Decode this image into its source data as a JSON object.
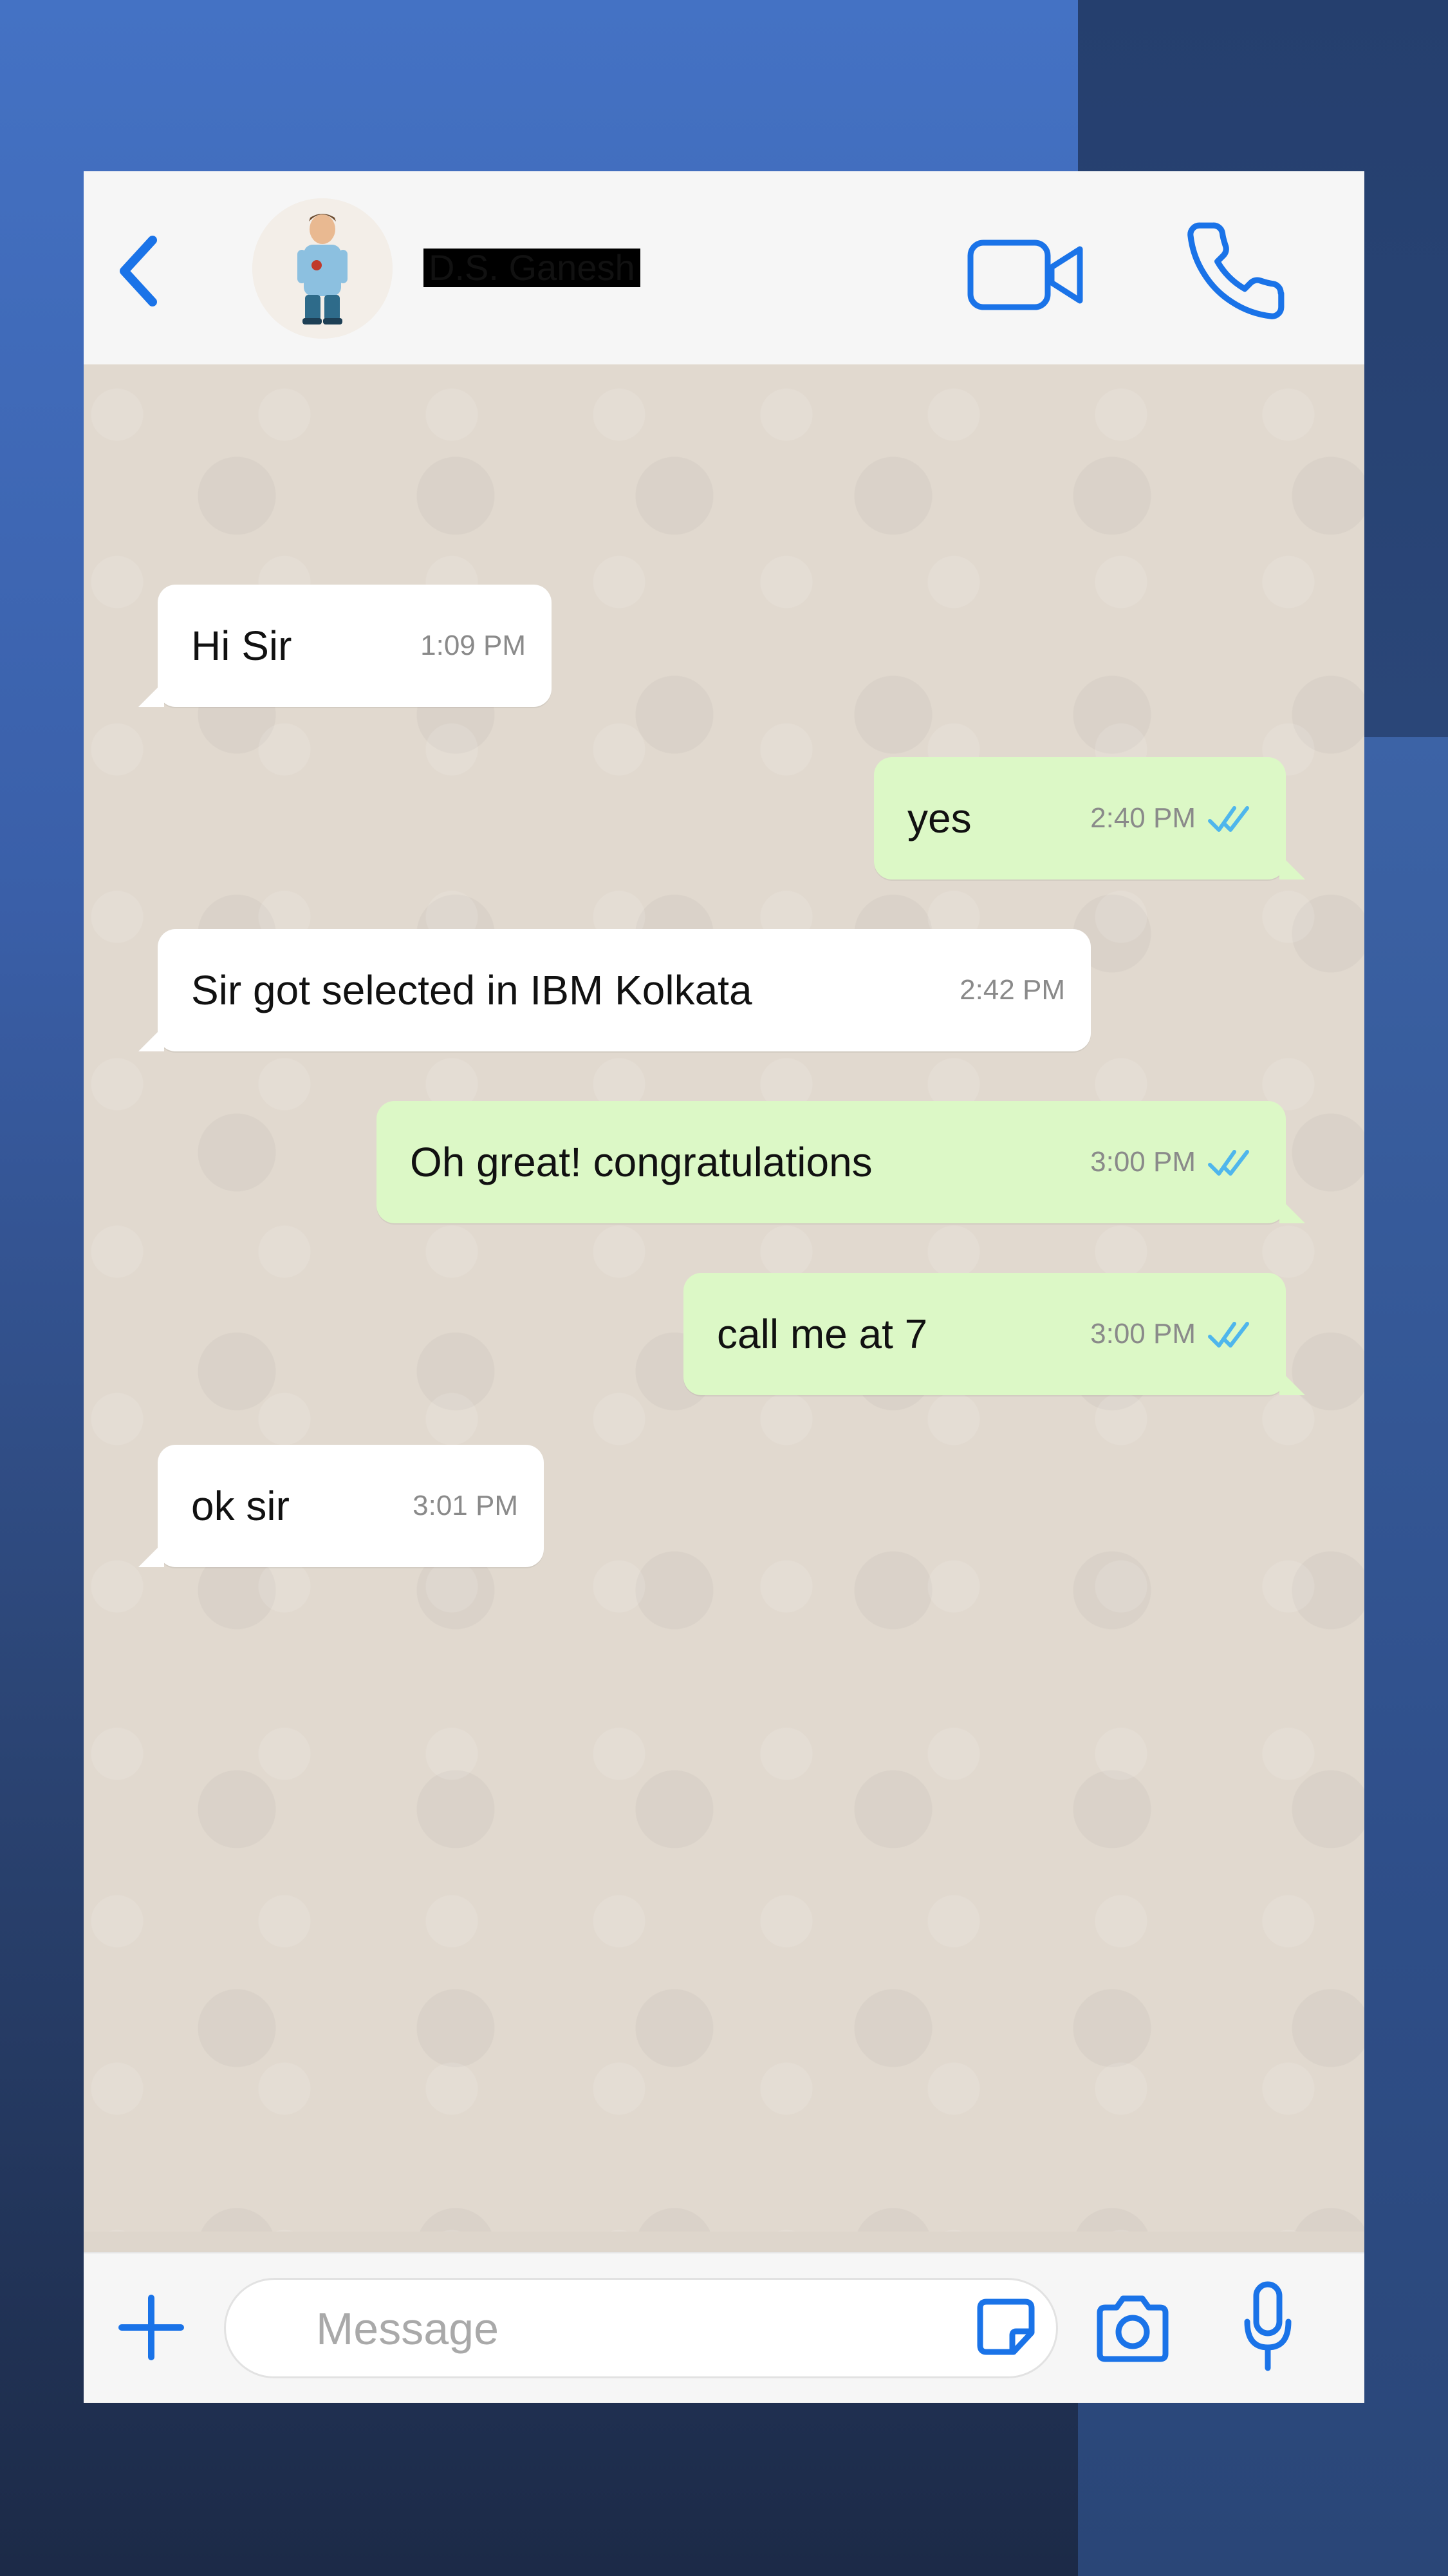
{
  "header": {
    "contact_name": "D.S. Ganesh",
    "back_icon": "chevron-left-icon",
    "video_icon": "video-camera-icon",
    "call_icon": "phone-icon"
  },
  "messages": [
    {
      "direction": "incoming",
      "text": "Hi Sir",
      "time": "1:09 PM"
    },
    {
      "direction": "outgoing",
      "text": "yes",
      "time": "2:40 PM",
      "status": "read"
    },
    {
      "direction": "incoming",
      "text": "Sir got selected in IBM Kolkata",
      "time": "2:42 PM"
    },
    {
      "direction": "outgoing",
      "text": "Oh great! congratulations",
      "time": "3:00 PM",
      "status": "read"
    },
    {
      "direction": "outgoing",
      "text": "call me at 7",
      "time": "3:00 PM",
      "status": "read"
    },
    {
      "direction": "incoming",
      "text": "ok sir",
      "time": "3:01 PM"
    }
  ],
  "composer": {
    "placeholder": "Message",
    "value": "",
    "plus_icon": "plus-icon",
    "sticker_icon": "sticker-icon",
    "camera_icon": "camera-icon",
    "mic_icon": "microphone-icon"
  },
  "colors": {
    "accent": "#1a73e8",
    "incoming_bubble": "#ffffff",
    "outgoing_bubble": "#dcf8c6",
    "read_tick": "#4fb6ec",
    "chat_background": "#e1d9cf"
  }
}
